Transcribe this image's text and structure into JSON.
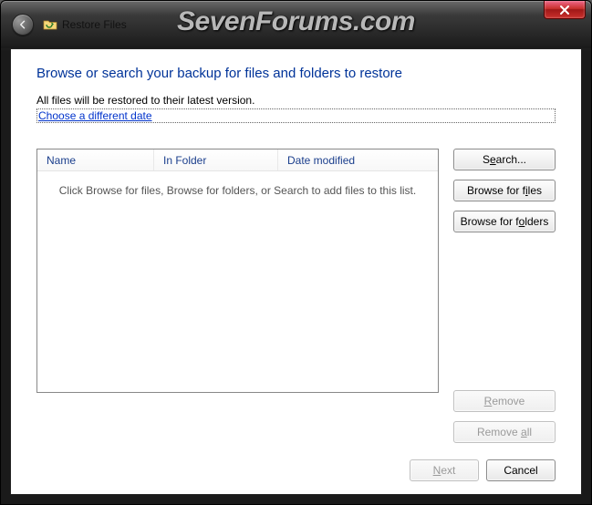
{
  "titlebar": {
    "breadcrumb": "Restore Files",
    "watermark": "SevenForums.com"
  },
  "page": {
    "heading": "Browse or search your backup for files and folders to restore",
    "subtext": "All files will be restored to their latest version.",
    "link": "Choose a different date"
  },
  "list": {
    "columns": {
      "name": "Name",
      "folder": "In Folder",
      "date": "Date modified"
    },
    "empty_text": "Click Browse for files, Browse for folders, or Search to add files to this list."
  },
  "buttons": {
    "search_pre": "S",
    "search_u": "e",
    "search_post": "arch...",
    "browse_files_pre": "Browse for f",
    "browse_files_u": "i",
    "browse_files_post": "les",
    "browse_folders_pre": "Browse for f",
    "browse_folders_u": "o",
    "browse_folders_post": "lders",
    "remove_pre": "",
    "remove_u": "R",
    "remove_post": "emove",
    "remove_all_pre": "Remove ",
    "remove_all_u": "a",
    "remove_all_post": "ll",
    "next_pre": "",
    "next_u": "N",
    "next_post": "ext",
    "cancel": "Cancel"
  }
}
